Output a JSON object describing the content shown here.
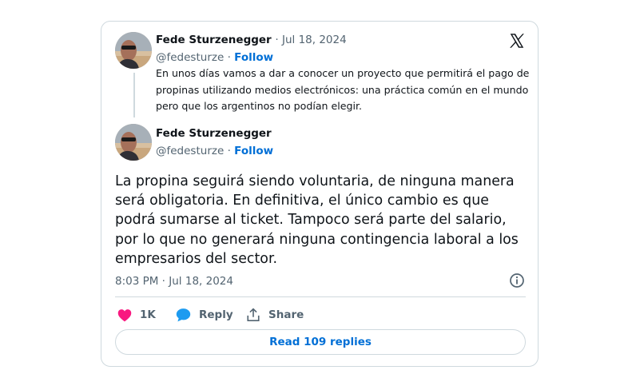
{
  "quoted_post": {
    "author_name": "Fede Sturzenegger",
    "date": "· Jul 18, 2024",
    "handle": "@fedesturze",
    "separator": "·",
    "follow_label": "Follow",
    "text": "En unos días vamos a dar a conocer un proyecto que permitirá el pago de propinas utilizando medios electrónicos: una práctica común en el mundo pero que los argentinos no podían elegir."
  },
  "main_post": {
    "author_name": "Fede Sturzenegger",
    "handle": "@fedesturze",
    "separator": "·",
    "follow_label": "Follow",
    "text": "La propina seguirá siendo voluntaria, de ninguna manera será obligatoria. En definitiva, el único cambio es que podrá sumarse al ticket. Tampoco será parte del salario, por lo que no generará ninguna contingencia laboral a los empresarios del sector.",
    "timestamp": "8:03 PM · Jul 18, 2024"
  },
  "actions": {
    "likes": "1K",
    "reply_label": "Reply",
    "share_label": "Share"
  },
  "read_replies_label": "Read 109 replies",
  "colors": {
    "link_blue": "#006fd6",
    "heart_pink": "#f91880",
    "reply_blue": "#1d9bf0",
    "muted_text": "#536471",
    "border": "#cfd9de"
  },
  "icons": [
    "x-logo-icon",
    "heart-icon",
    "reply-bubble-icon",
    "share-icon",
    "info-icon"
  ]
}
